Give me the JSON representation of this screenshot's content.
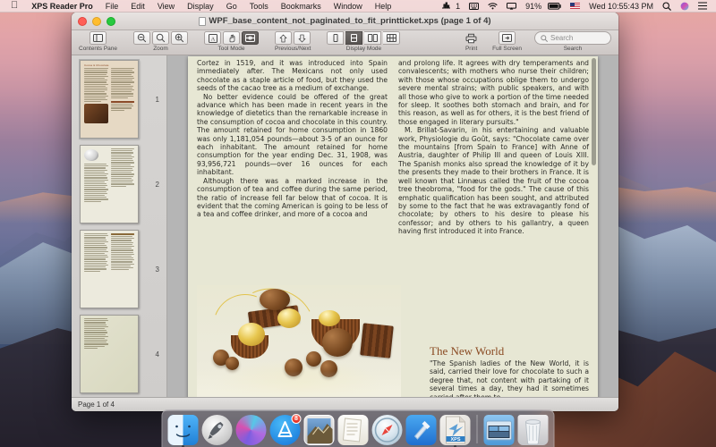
{
  "menubar": {
    "apple_icon": "apple-logo-icon",
    "app_name": "XPS Reader Pro",
    "items": [
      "File",
      "Edit",
      "View",
      "Display",
      "Go",
      "Tools",
      "Bookmarks",
      "Window",
      "Help"
    ],
    "status": {
      "audio_meter_value": "1",
      "battery_percent": "91%",
      "clock": "Wed 10:55:43 PM",
      "input_flag": "US",
      "icons": [
        "sound-meter-icon",
        "keyboard-input-icon",
        "wifi-icon",
        "airplay-icon",
        "battery-icon",
        "flag-icon",
        "spotlight-search-icon",
        "siri-icon",
        "notification-center-icon"
      ]
    }
  },
  "window": {
    "title": "WPF_base_content_not_paginated_to_fit_printticket.xps (page 1 of 4)",
    "traffic_lights": [
      "close",
      "minimize",
      "zoom"
    ]
  },
  "toolbar": {
    "groups": [
      {
        "label": "Contents Pane",
        "buttons": [
          {
            "icon": "sidebar-toggle-icon",
            "active": false
          }
        ]
      },
      {
        "label": "Zoom",
        "buttons": [
          {
            "icon": "zoom-out-icon",
            "active": false
          },
          {
            "icon": "zoom-reset-icon",
            "active": false
          },
          {
            "icon": "zoom-in-icon",
            "active": false
          }
        ]
      },
      {
        "label": "Tool Mode",
        "buttons": [
          {
            "icon": "text-select-icon",
            "active": false
          },
          {
            "icon": "hand-pan-icon",
            "active": false
          },
          {
            "icon": "marquee-select-icon",
            "active": true
          }
        ]
      },
      {
        "label": "Previous/Next",
        "buttons": [
          {
            "icon": "arrow-up-icon",
            "active": false
          },
          {
            "icon": "arrow-down-icon",
            "active": false
          }
        ]
      },
      {
        "label": "Display Mode",
        "buttons": [
          {
            "icon": "single-page-icon",
            "active": false
          },
          {
            "icon": "continuous-page-icon",
            "active": true
          },
          {
            "icon": "two-page-icon",
            "active": false
          },
          {
            "icon": "grid-page-icon",
            "active": false
          }
        ]
      }
    ],
    "print": {
      "label": "Print",
      "icon": "printer-icon"
    },
    "full_screen": {
      "label": "Full Screen",
      "icon": "full-screen-icon"
    },
    "search": {
      "label": "Search",
      "placeholder": "Search",
      "icon": "search-icon",
      "value": ""
    }
  },
  "sidebar": {
    "thumbnails": [
      {
        "number": "1",
        "selected": true,
        "heading": "Cocoa & Chocolate"
      },
      {
        "number": "2",
        "selected": false,
        "heading": ""
      },
      {
        "number": "3",
        "selected": false,
        "heading": ""
      },
      {
        "number": "4",
        "selected": false,
        "heading": ""
      }
    ]
  },
  "document": {
    "left_column": [
      "Cortez in 1519, and it was introduced into Spain immediately after. The Mexicans not only used chocolate as a staple article of food, but they used the seeds of the cacao tree as a medium of exchange.",
      "No better evidence could be offered of the great advance which has been made in recent years in the knowledge of dietetics than the remarkable increase in the consumption of cocoa and chocolate in this country. The amount retained for home consumption in 1860 was only 1,181,054 pounds—about 3-5 of an ounce for each inhabitant. The amount retained for home consumption for the year ending Dec. 31, 1908, was 93,956,721 pounds—over 16 ounces for each inhabitant.",
      "Although there was a marked increase in the consumption of tea and coffee during the same period, the ratio of increase fell far below that of cocoa. It is evident that the coming American is going to be less of a tea and coffee drinker, and more of a cocoa and"
    ],
    "right_column": [
      "and prolong life. It agrees with dry temperaments and convalescents; with mothers who nurse their children; with those whose occupations oblige them to undergo severe mental strains; with public speakers, and with all those who give to work a portion of the time needed for sleep. It soothes both stomach and brain, and for this reason, as well as for others, it is the best friend of those engaged in literary pursuits.\"",
      "M. Brillat-Savarin, in his entertaining and valuable work, Physiologie du Goût, says: \"Chocolate came over the mountains [from Spain to France] with Anne of Austria, daughter of Philip III and queen of Louis XIII. The Spanish monks also spread the knowledge of it by the presents they made to their brothers in France. It is well known that Linnæus called the fruit of the cocoa tree theobroma, \"food for the gods.\" The cause of this emphatic qualification has been sought, and attributed by some to the fact that he was extravagantly fond of chocolate; by others to his desire to please his confessor; and by others to his gallantry, a queen having first introduced it into France."
    ],
    "new_world": {
      "title": "The New World",
      "body": "\"The Spanish ladies of the New World, it is said, carried their love for chocolate to such a degree that, not content with partaking of it several times a day, they had it sometimes carried after them to"
    },
    "hero_image_alt": "chocolate-truffles-photo"
  },
  "statusbar": {
    "page_label": "Page 1 of 4"
  },
  "dock": {
    "items": [
      {
        "name": "finder",
        "label": "Finder",
        "running": true,
        "badge": ""
      },
      {
        "name": "launchpad",
        "label": "Launchpad",
        "running": false,
        "badge": ""
      },
      {
        "name": "siri",
        "label": "Siri",
        "running": false,
        "badge": ""
      },
      {
        "name": "app-store",
        "label": "App Store",
        "running": false,
        "badge": "8"
      },
      {
        "name": "mail",
        "label": "Mail",
        "running": false,
        "badge": ""
      },
      {
        "name": "notes",
        "label": "Notes",
        "running": false,
        "badge": ""
      },
      {
        "name": "safari",
        "label": "Safari",
        "running": false,
        "badge": ""
      },
      {
        "name": "xcode",
        "label": "Xcode",
        "running": false,
        "badge": ""
      },
      {
        "name": "xps-reader-pro",
        "label": "XPS",
        "running": true,
        "badge": ""
      },
      {
        "name": "downloads",
        "label": "Downloads",
        "running": false,
        "badge": ""
      },
      {
        "name": "trash",
        "label": "Trash",
        "running": false,
        "badge": ""
      }
    ]
  },
  "colors": {
    "menubar_bg": "#f4dede",
    "window_chrome": "#d6d0ce",
    "page_bg": "#e7e7d4",
    "heading_brown": "#8a4a22",
    "badge_red": "#e02b1d",
    "toolbar_active": "#58544f"
  }
}
